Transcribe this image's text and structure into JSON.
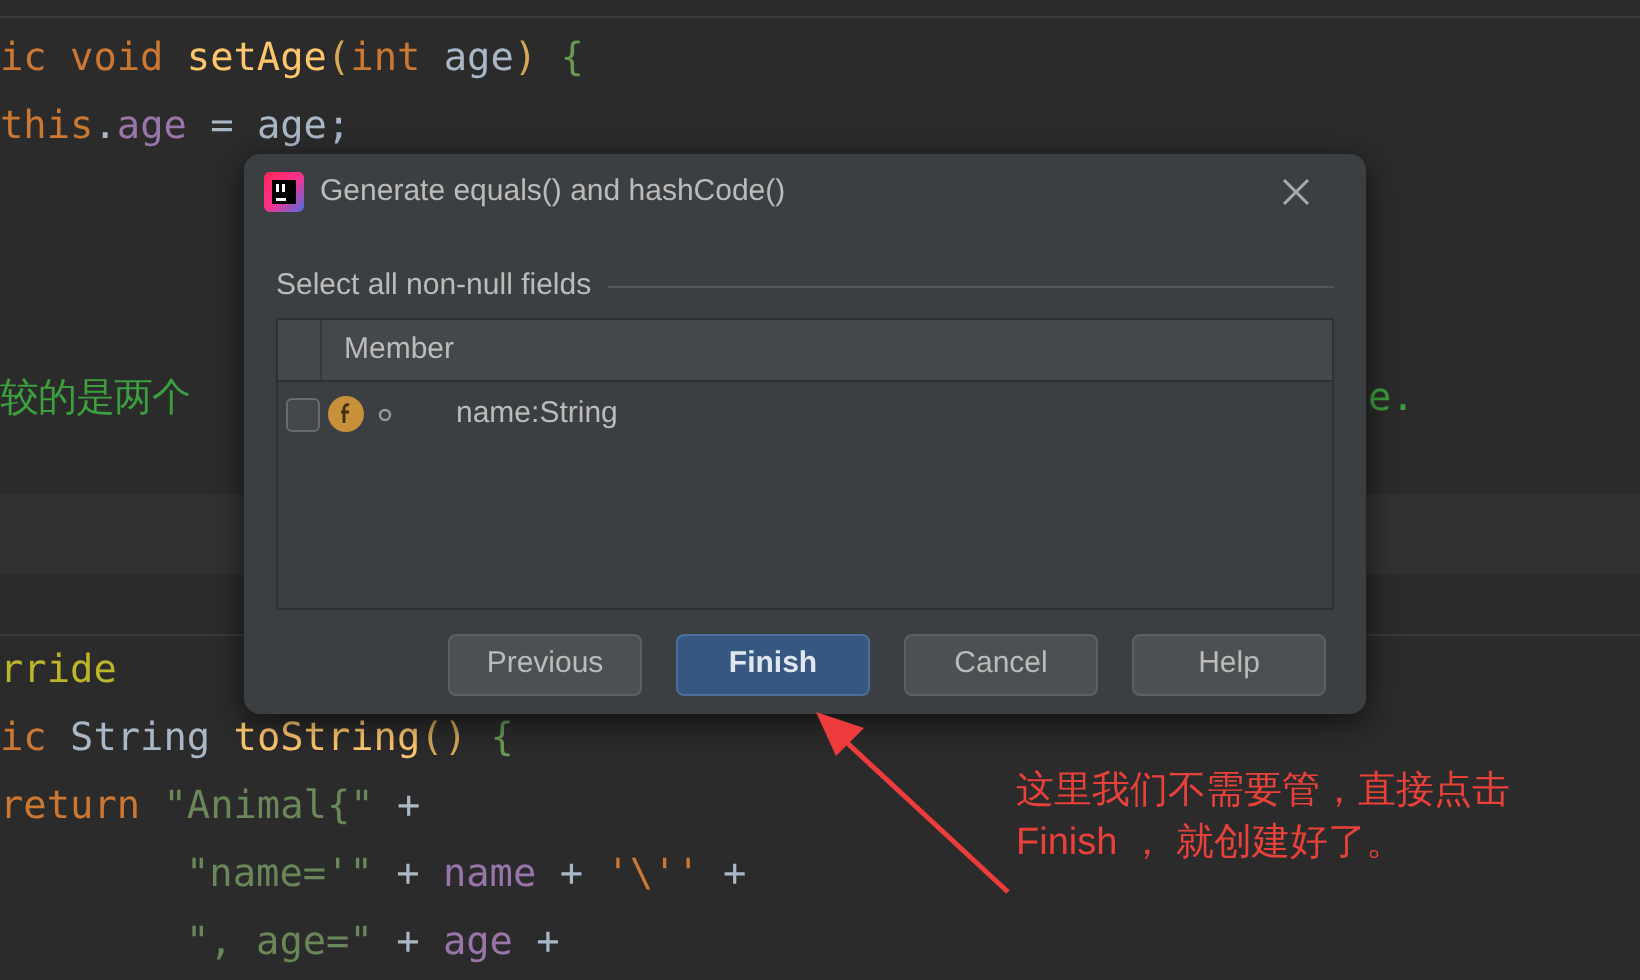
{
  "editor": {
    "lines": [
      {
        "tokens": [
          {
            "text": "ic void ",
            "kind": "keyword"
          },
          {
            "text": "setAge",
            "kind": "method"
          },
          {
            "text": "(",
            "kind": "punct"
          },
          {
            "text": "int ",
            "kind": "keyword"
          },
          {
            "text": "age",
            "kind": "plain"
          },
          {
            "text": ") ",
            "kind": "punct"
          },
          {
            "text": "{",
            "kind": "brace"
          }
        ]
      },
      {
        "tokens": [
          {
            "text": "this",
            "kind": "keyword"
          },
          {
            "text": ".",
            "kind": "plain"
          },
          {
            "text": "age",
            "kind": "field"
          },
          {
            "text": " = age;",
            "kind": "plain"
          }
        ]
      },
      {
        "kind": "blank"
      },
      {
        "kind": "blank"
      },
      {
        "kind": "blank"
      },
      {
        "tokens": [
          {
            "text": "较的是两个",
            "kind": "comment"
          }
        ],
        "tail": "e."
      },
      {
        "kind": "blank"
      },
      {
        "kind": "band"
      },
      {
        "kind": "rule"
      },
      {
        "tokens": [
          {
            "text": "rride",
            "kind": "annotation"
          }
        ]
      },
      {
        "tokens": [
          {
            "text": "ic ",
            "kind": "keyword"
          },
          {
            "text": "String ",
            "kind": "plain"
          },
          {
            "text": "toString",
            "kind": "method"
          },
          {
            "text": "() ",
            "kind": "punct"
          },
          {
            "text": "{",
            "kind": "brace"
          }
        ]
      },
      {
        "tokens": [
          {
            "text": "return ",
            "kind": "keyword"
          },
          {
            "text": "\"Animal{\"",
            "kind": "string"
          },
          {
            "text": " +",
            "kind": "plain"
          }
        ]
      },
      {
        "indent": true,
        "tokens": [
          {
            "text": "\"name='\"",
            "kind": "string"
          },
          {
            "text": " + ",
            "kind": "plain"
          },
          {
            "text": "name",
            "kind": "field"
          },
          {
            "text": " + ",
            "kind": "plain"
          },
          {
            "text": "'\\''",
            "kind": "char"
          },
          {
            "text": " +",
            "kind": "plain"
          }
        ]
      },
      {
        "indent": true,
        "tokens": [
          {
            "text": "\", age=\"",
            "kind": "string"
          },
          {
            "text": " + ",
            "kind": "plain"
          },
          {
            "text": "age",
            "kind": "field"
          },
          {
            "text": " +",
            "kind": "plain"
          }
        ]
      }
    ]
  },
  "dialog": {
    "title": "Generate equals() and hashCode()",
    "section": "Select all non-null fields",
    "table": {
      "columns": [
        "Member"
      ],
      "rows": [
        {
          "member": "name:String",
          "checked": false
        }
      ]
    },
    "buttons": [
      {
        "label": "Previous",
        "kind": "normal"
      },
      {
        "label": "Finish",
        "kind": "default"
      },
      {
        "label": "Cancel",
        "kind": "normal"
      },
      {
        "label": "Help",
        "kind": "normal"
      }
    ]
  },
  "annotation": {
    "lines": [
      "这里我们不需要管，直接点击",
      "Finish ， 就创建好了。"
    ]
  }
}
